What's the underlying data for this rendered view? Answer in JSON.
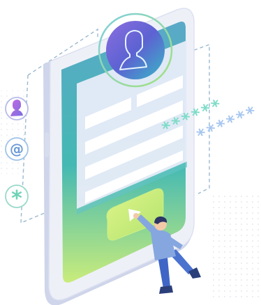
{
  "illustration": {
    "password_row_1": "******",
    "password_row_2": "******",
    "email_symbol": "@",
    "asterisk_symbol": "*",
    "colors": {
      "phone_frame": "#eef0f8",
      "screen_teal": "#46b6b8",
      "screen_lime": "#c6ea7a",
      "avatar_purple": "#6f5cc9",
      "icon_mint": "#7fdcc8",
      "person_shirt": "#86a6df",
      "person_pants": "#3f66c6"
    },
    "icons": [
      "user-icon",
      "at-sign-icon",
      "asterisk-icon",
      "play-icon"
    ]
  }
}
